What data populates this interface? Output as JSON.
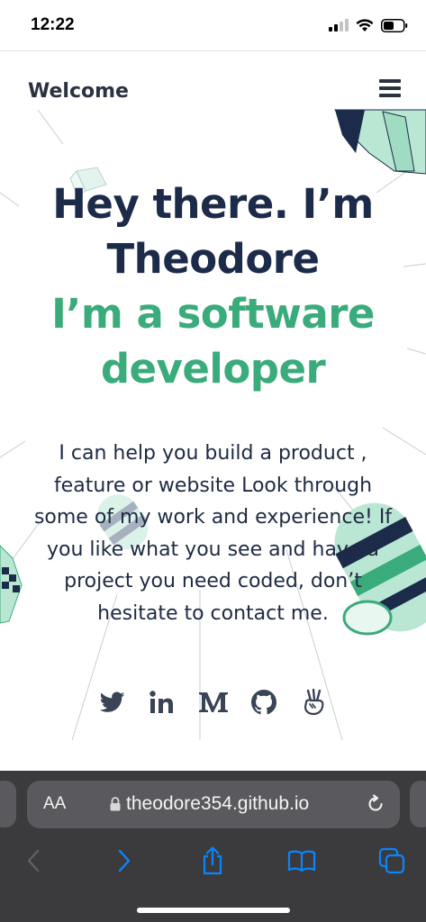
{
  "status_bar": {
    "time": "12:22",
    "icons": [
      "signal-icon",
      "wifi-icon",
      "battery-icon"
    ]
  },
  "header": {
    "title": "Welcome",
    "menu_icon": "hamburger-menu-icon"
  },
  "hero": {
    "line1": "Hey there. I’m",
    "line2": "Theodore",
    "line3": "I’m a software",
    "line4": "developer",
    "colors": {
      "primary": "#1c2b4a",
      "accent": "#3aab7b"
    }
  },
  "intro": {
    "lines": [
      "I can help you build a product ,",
      "feature or website Look through",
      "some of my work and experience! If",
      "you like what you see and have a",
      "project you need coded, don’t",
      "hesitate to contact me."
    ]
  },
  "socials": [
    {
      "name": "twitter",
      "icon": "twitter-icon"
    },
    {
      "name": "linkedin",
      "icon": "linkedin-icon"
    },
    {
      "name": "medium",
      "icon": "medium-icon"
    },
    {
      "name": "github",
      "icon": "github-icon"
    },
    {
      "name": "angellist",
      "icon": "angellist-icon"
    }
  ],
  "browser": {
    "text_size_label": "AA",
    "url": "theodore354.github.io",
    "toolbar_icons": [
      "back-icon",
      "forward-icon",
      "share-icon",
      "bookmarks-icon",
      "tabs-icon"
    ],
    "accent_color": "#0a84ff"
  }
}
